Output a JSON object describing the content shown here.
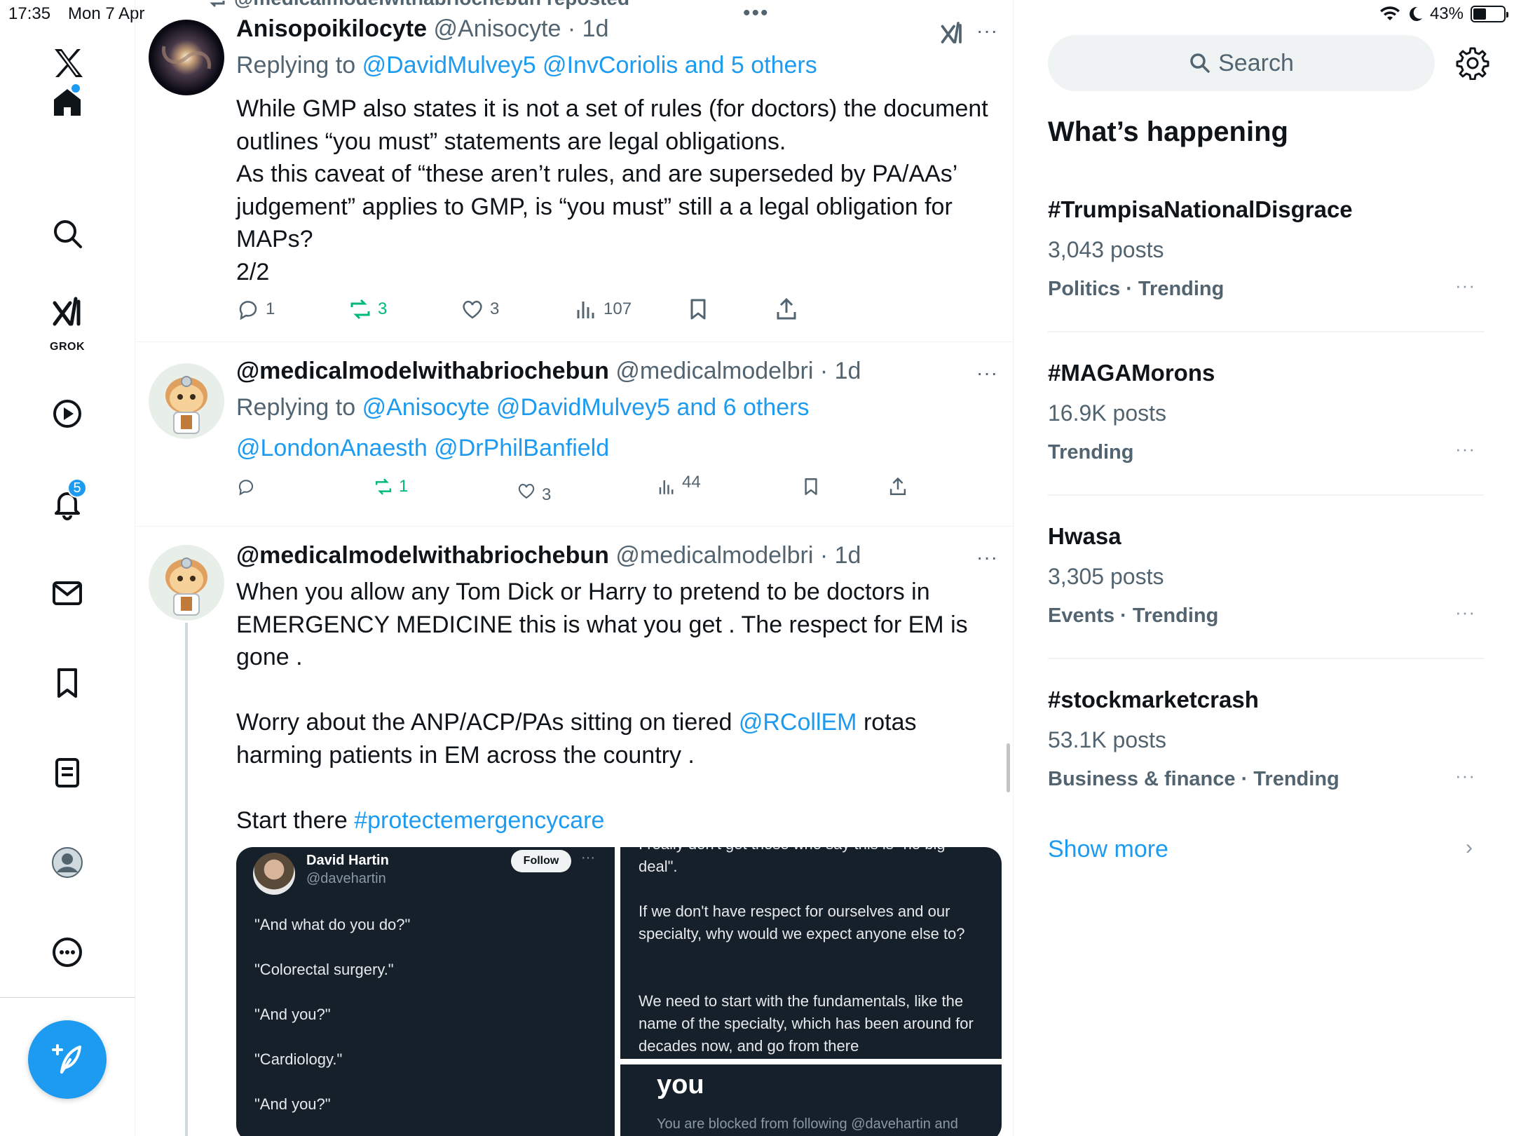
{
  "status": {
    "time": "17:35",
    "date": "Mon 7 Apr",
    "battery": "43%",
    "battery_level": 0.43
  },
  "nav": {
    "items": [
      "home",
      "explore",
      "grok",
      "video",
      "notifications",
      "messages",
      "bookmarks",
      "lists",
      "profile",
      "more"
    ],
    "grok_label": "GROK",
    "notifications_badge": "5"
  },
  "repost_banner": "@medicalmodelwithabriochebun reposted",
  "top_more": "•••",
  "tweets": [
    {
      "name": "Anisopoikilocyte",
      "handle": "@Anisocyte",
      "time": "· 1d",
      "replying_prefix": "Replying to",
      "replying_links": "@DavidMulvey5 @InvCoriolis and 5 others",
      "body": [
        "While GMP also states it is not a set of rules (for doctors) the document outlines “you must” statements are legal obligations.",
        "As this caveat of “these aren’t rules, and are superseded by PA/AAs’ judgement” applies to GMP, is “you must” still a a legal obligation for MAPs?",
        "2/2"
      ],
      "replies": "1",
      "reposts": "3",
      "likes": "3",
      "views": "107"
    },
    {
      "name": "@medicalmodelwithabriochebun",
      "handle": "@medicalmodelbri",
      "time": "· 1d",
      "replying_prefix": "Replying to",
      "replying_links": "@Anisocyte @DavidMulvey5 and 6 others",
      "mentions": "@LondonAnaesth @DrPhilBanfield",
      "replies": "",
      "reposts": "1",
      "likes": "3",
      "views": "44"
    },
    {
      "name": "@medicalmodelwithabriochebun",
      "handle": "@medicalmodelbri",
      "time": "· 1d",
      "body1": "When you allow any Tom Dick or Harry to pretend to be doctors in EMERGENCY MEDICINE this is what you get . The respect for EM is gone .",
      "body2_pre": "Worry about the ANP/ACP/PAs sitting on tiered ",
      "body2_link": "@RCollEM",
      "body2_post": " rotas harming patients in EM across the country .",
      "body3_pre": "Start there ",
      "body3_link": "#protectemergencycare"
    }
  ],
  "media": {
    "left": {
      "name": "David Hartin",
      "handle": "@davehartin",
      "follow": "Follow",
      "dots": "···",
      "lines": [
        "\"And what do you do?\"",
        "\"Colorectal surgery.\"",
        "\"And you?\"",
        "\"Cardiology.\"",
        "\"And you?\""
      ]
    },
    "right_top": {
      "line0": "I really don't get those who say this is \"no big",
      "line1": "deal\".",
      "para2": "If we don't have respect for ourselves and our specialty, why would we expect anyone else to?",
      "para3": "We need to start with the fundamentals, like the name of the specialty, which has been around for decades now, and go from there"
    },
    "right_bottom": {
      "big": "you",
      "blocked": "You are blocked from following @davehartin and viewing @davehartin's posts"
    }
  },
  "sidebar": {
    "search_placeholder": "Search",
    "title": "What’s happening",
    "trends": [
      {
        "name": "#TrumpisaNationalDisgrace",
        "posts": "3,043 posts",
        "category": "Politics · Trending"
      },
      {
        "name": "#MAGAMorons",
        "posts": "16.9K posts",
        "category": "Trending"
      },
      {
        "name": "Hwasa",
        "posts": "3,305 posts",
        "category": "Events · Trending"
      },
      {
        "name": "#stockmarketcrash",
        "posts": "53.1K posts",
        "category": "Business & finance · Trending"
      }
    ],
    "more_dots": "···",
    "show_more": "Show more",
    "show_more_chevron": "›"
  },
  "colors": {
    "accent": "#1d9bf0",
    "repost_green": "#00ba7c",
    "secondary_text": "#536471"
  }
}
